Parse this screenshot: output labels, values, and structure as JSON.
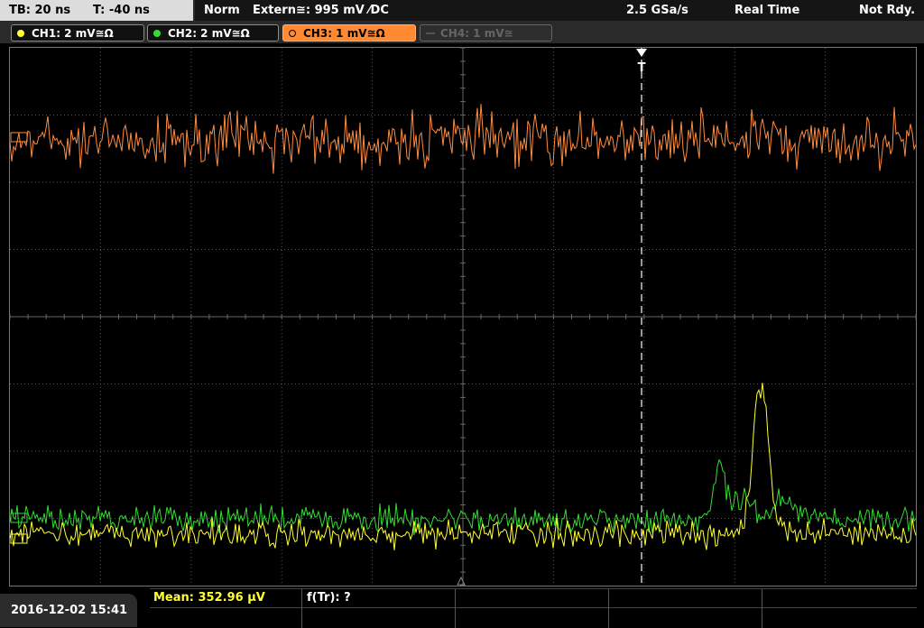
{
  "header": {
    "timebase": "TB: 20 ns",
    "trigger_time": "T: -40 ns",
    "mode": "Norm",
    "trigger_source": "Extern≅: 995 mV ⁄DC",
    "sample_rate": "2.5 GSa/s",
    "acq_mode": "Real Time",
    "status": "Not Rdy."
  },
  "channels": [
    {
      "label": "CH1: 2 mV≅Ω",
      "color": "#ffff33",
      "active": true
    },
    {
      "label": "CH2: 2 mV≅Ω",
      "color": "#33dd33",
      "active": true
    },
    {
      "label": "CH3: 1 mV≅Ω",
      "color": "#ff8a33",
      "active": true,
      "selected": true
    },
    {
      "label": "CH4: 1 mV≅",
      "color": "#777777",
      "active": false
    }
  ],
  "trigger_marker": "T",
  "footer": {
    "datetime": "2016-12-02 15:41",
    "mean_label": "Mean: 352.96 µV",
    "freq_label": "f(Tr): ?"
  },
  "colors": {
    "ch1": "#ffff33",
    "ch2": "#33dd33",
    "ch3": "#ff8c40",
    "grid": "#555555",
    "trigger_line": "#ffffff"
  }
}
